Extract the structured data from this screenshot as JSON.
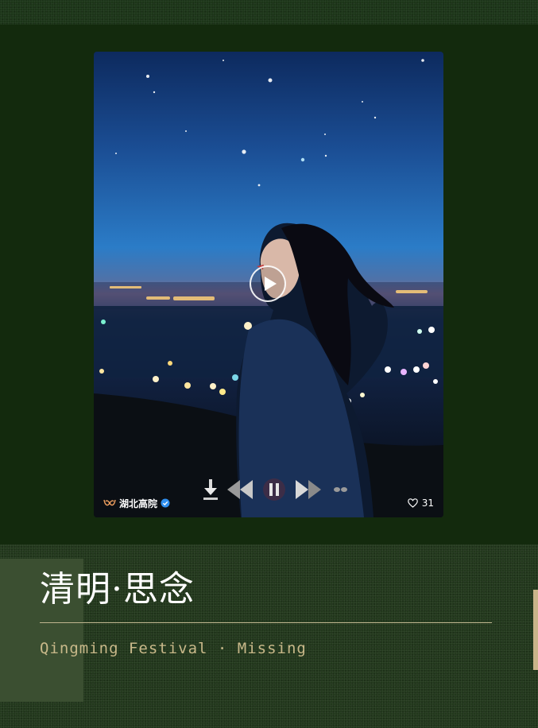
{
  "video": {
    "account_name": "湖北高院",
    "like_count": "31",
    "icons": {
      "play": "play-circle-icon",
      "download": "download-icon",
      "rewind": "rewind-icon",
      "pause": "pause-icon",
      "forward": "fast-forward-icon",
      "more": "more-icon",
      "verified": "verified-badge-icon",
      "logo": "channel-logo-icon",
      "like": "heart-icon"
    }
  },
  "section": {
    "title": "清明·思念",
    "subtitle": "Qingming Festival · Missing"
  },
  "colors": {
    "dark_green": "#132a0d",
    "textured_green": "#22381c",
    "side_block": "#3b4f31",
    "accent_gold": "#c9b98a",
    "verified_blue": "#2f8ff0"
  }
}
